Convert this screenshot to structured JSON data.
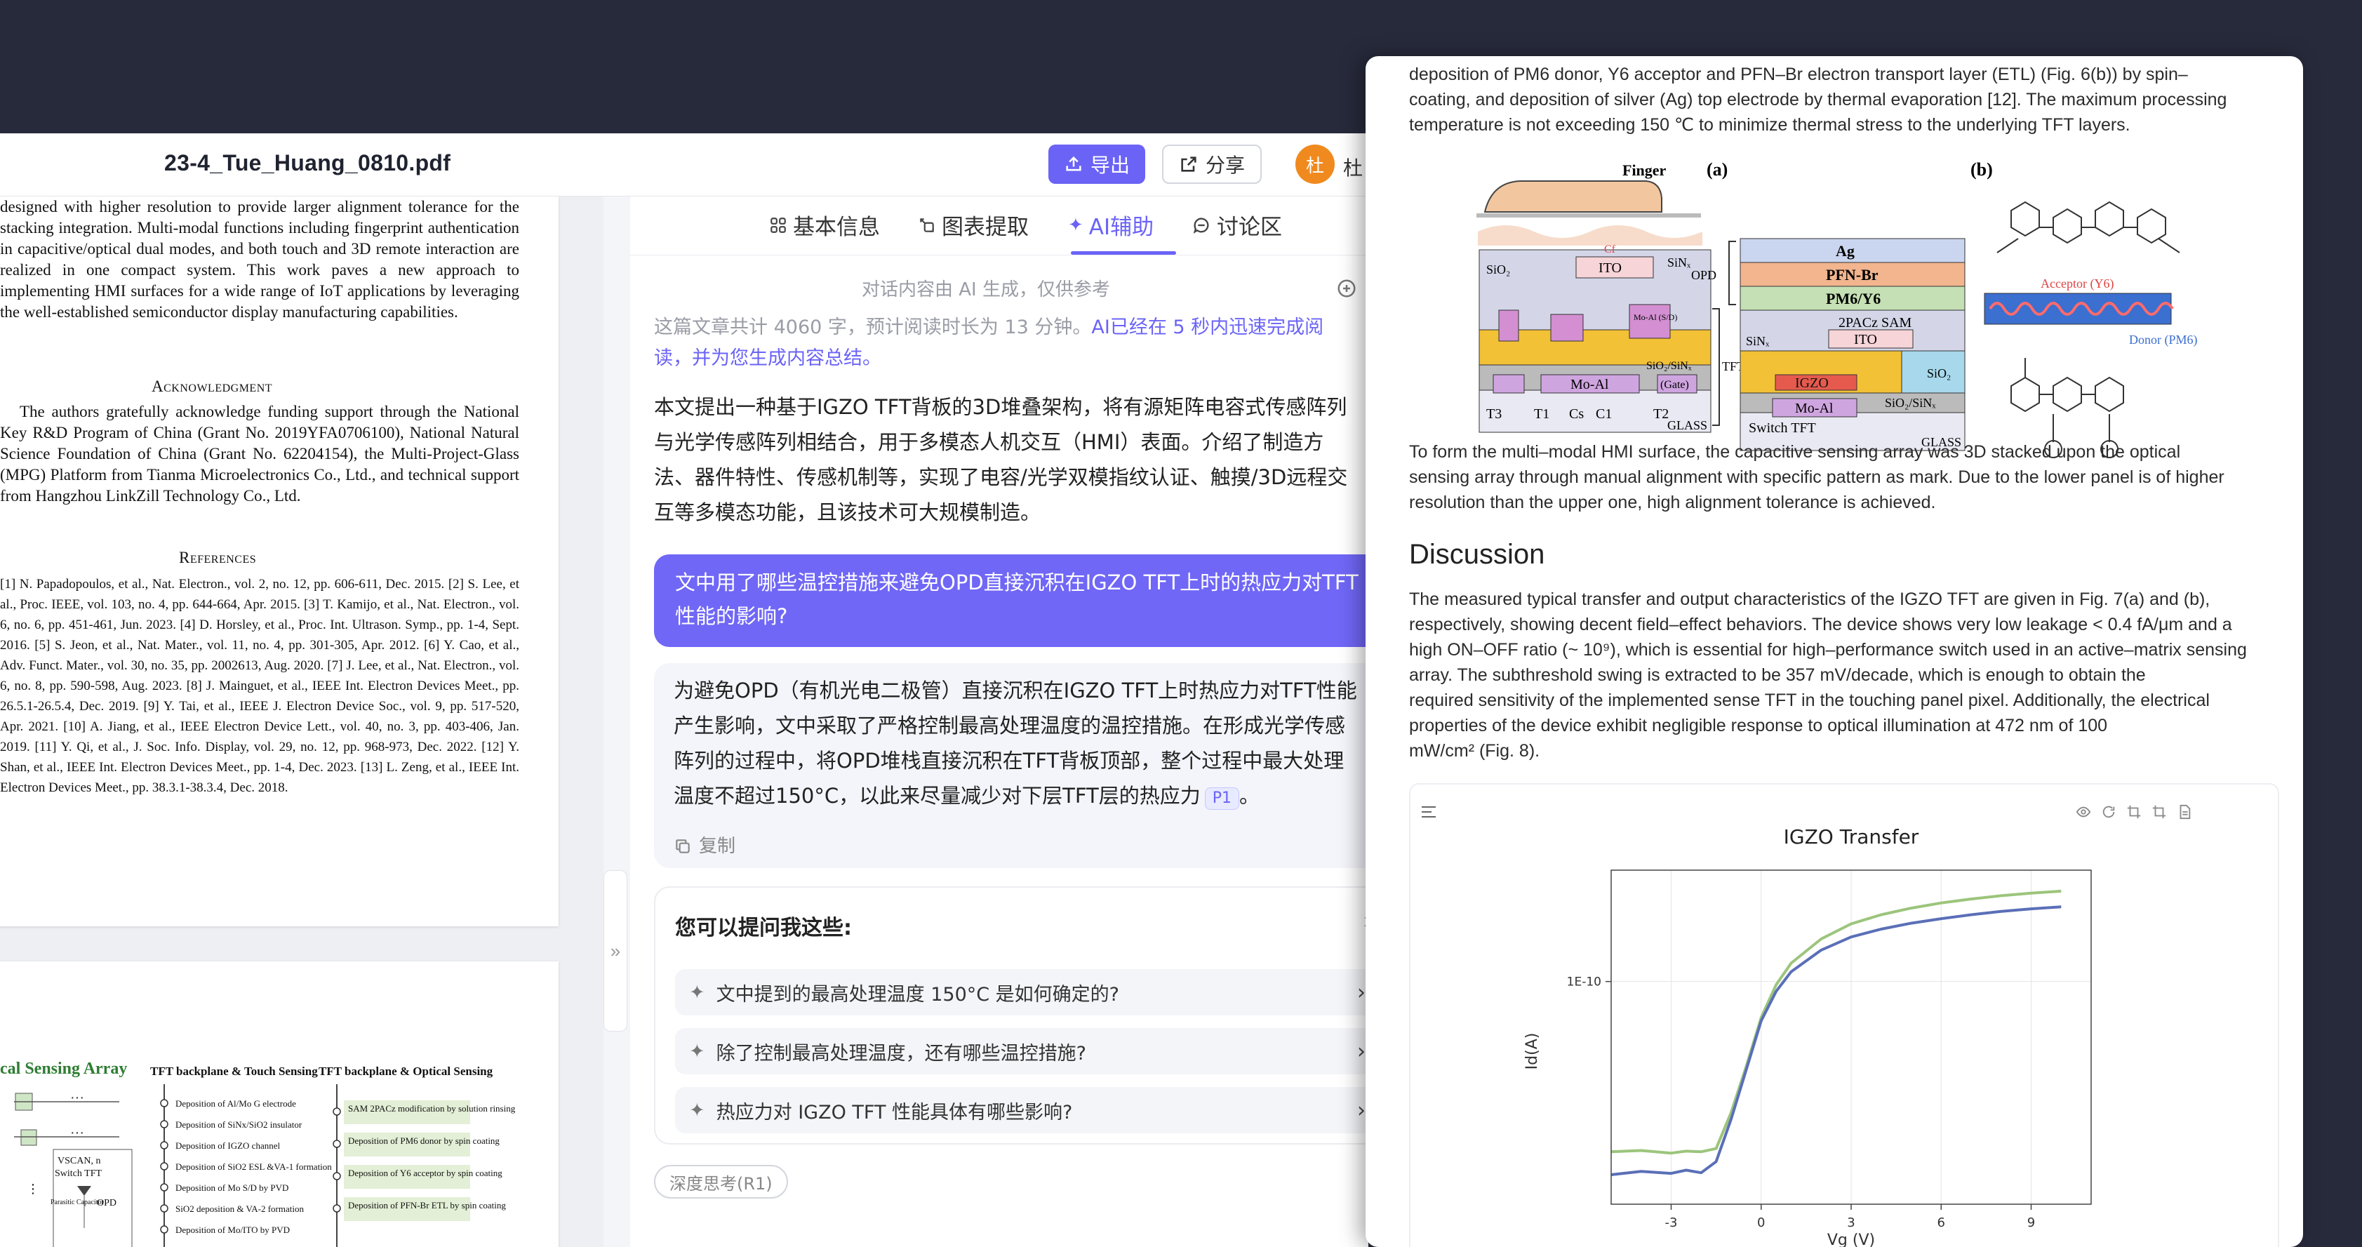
{
  "app": {
    "doc_title": "23-4_Tue_Huang_0810.pdf",
    "export_label": "导出",
    "share_label": "分享",
    "avatar_text": "杜",
    "username": "杜"
  },
  "pdf": {
    "page1_paragraph": "designed with higher resolution to provide larger alignment tolerance for the stacking integration. Multi-modal functions including fingerprint authentication in capacitive/optical dual modes, and both touch and 3D remote interaction are realized in one compact system. This work paves a new approach to implementing HMI surfaces for a wide range of IoT applications by leveraging the well-established semiconductor display manufacturing capabilities.",
    "ack_heading": "Acknowledgment",
    "ack_text": "The authors gratefully acknowledge funding support through the National Key R&D Program of China (Grant No. 2019YFA0706100), National Natural Science Foundation of China (Grant No. 62204154), the Multi-Project-Glass (MPG) Platform from Tianma Microelectronics Co., Ltd., and technical support from Hangzhou LinkZill Technology Co., Ltd.",
    "ref_heading": "References",
    "ref_text": "[1] N. Papadopoulos, et al., Nat. Electron., vol. 2, no. 12, pp. 606-611, Dec. 2015. [2] S. Lee, et al., Proc. IEEE, vol. 103, no. 4, pp. 644-664, Apr. 2015. [3] T. Kamijo, et al., Nat. Electron., vol. 6, no. 6, pp. 451-461, Jun. 2023. [4] D. Horsley, et al., Proc. Int. Ultrason. Symp., pp. 1-4, Sept. 2016. [5] S. Jeon, et al., Nat. Mater., vol. 11, no. 4, pp. 301-305, Apr. 2012. [6] Y. Cao, et al., Adv. Funct. Mater., vol. 30, no. 35, pp. 2002613, Aug. 2020. [7] J. Lee, et al., Nat. Electron., vol. 6, no. 8, pp. 590-598, Aug. 2023. [8] J. Mainguet, et al., IEEE Int. Electron Devices Meet., pp. 26.5.1-26.5.4, Dec. 2019. [9] Y. Tai, et al., IEEE J. Electron Device Soc., vol. 9, pp. 517-520, Apr. 2021. [10] A. Jiang, et al., IEEE Electron Device Lett., vol. 40, no. 3, pp. 403-406, Jan. 2019. [11] Y. Qi, et al., J. Soc. Info. Display, vol. 29, no. 12, pp. 968-973, Dec. 2022. [12] Y. Shan, et al., IEEE Int. Electron Devices Meet., pp. 1-4, Dec. 2023. [13] L. Zeng, et al., IEEE Int. Electron Devices Meet., pp. 38.3.1-38.3.4, Dec. 2018.",
    "fig_col1_title": "cal Sensing Array",
    "fig_col2_title": "TFT backplane & Touch Sensing",
    "fig_col3_title": "TFT backplane & Optical Sensing",
    "fig_col2_steps": [
      "Deposition of Al/Mo G electrode",
      "Deposition of SiNx/SiO2 insulator",
      "Deposition of IGZO channel",
      "Deposition of SiO2 ESL &VA-1 formation",
      "Deposition of Mo S/D by PVD",
      "SiO2 deposition & VA-2 formation",
      "Deposition of Mo/ITO by PVD"
    ],
    "fig_col3_steps": [
      "SAM 2PACz modification by solution rinsing",
      "Deposition of PM6 donor by spin coating",
      "Deposition of Y6 acceptor by spin coating",
      "Deposition of PFN-Br ETL by spin coating"
    ],
    "fig_labels": [
      "VSCAN, n",
      "Switch TFT",
      "Parasitic Capacitor",
      "OPD"
    ]
  },
  "ai_panel": {
    "tabs": [
      {
        "label": "基本信息",
        "icon": "grid-icon"
      },
      {
        "label": "图表提取",
        "icon": "chart-extract-icon"
      },
      {
        "label": "AI辅助",
        "icon": "sparkle-icon"
      },
      {
        "label": "讨论区",
        "icon": "chat-icon"
      }
    ],
    "active_tab": "AI辅助",
    "ai_note": "对话内容由 AI 生成，仅供参考",
    "summary_meta_prefix": "这篇文章共计 4060 字，预计阅读时长为 13 分钟。",
    "summary_meta_highlight": "AI已经在 5 秒内迅速完成阅读，并为您生成内容总结。",
    "summary_body": "本文提出一种基于IGZO TFT背板的3D堆叠架构，将有源矩阵电容式传感阵列与光学传感阵列相结合，用于多模态人机交互（HMI）表面。介绍了制造方法、器件特性、传感机制等，实现了电容/光学双模指纹认证、触摸/3D远程交互等多模态功能，且该技术可大规模制造。",
    "user_question": "文中用了哪些温控措施来避免OPD直接沉积在IGZO TFT上时的热应力对TFT性能的影响?",
    "answer_text": "为避免OPD（有机光电二极管）直接沉积在IGZO TFT上时热应力对TFT性能产生影响，文中采取了严格控制最高处理温度的温控措施。在形成光学传感阵列的过程中，将OPD堆栈直接沉积在TFT背板顶部，整个过程中最大处理温度不超过150°C，以此来尽量减少对下层TFT层的热应力",
    "answer_ref": "P1",
    "copy_label": "复制",
    "suggest_title": "您可以提问我这些:",
    "suggestions": [
      "文中提到的最高处理温度 150°C 是如何确定的?",
      "除了控制最高处理温度，还有哪些温控措施?",
      "热应力对 IGZO TFT 性能具体有哪些影响?"
    ],
    "deep_think_label": "深度思考(R1)"
  },
  "preview": {
    "intro_lines": [
      "deposition of PM6 donor, Y6 acceptor and PFN–Br electron transport layer (ETL) (Fig. 6(b)) by spin–",
      "coating, and deposition of silver (Ag) top electrode by thermal evaporation [12]. The maximum processing",
      "temperature is not exceeding 150 ℃ to minimize thermal stress to the underlying TFT layers."
    ],
    "figure": {
      "panel_a": "(a)",
      "panel_b": "(b)",
      "finger": "Finger",
      "opd": "OPD",
      "tft": "TFT",
      "glass": "GLASS",
      "ag": "Ag",
      "pfnbr": "PFN-Br",
      "pm6y6": "PM6/Y6",
      "sam": "2PACz SAM",
      "ito": "ITO",
      "sio2": "SiO₂",
      "sinx": "SiNₓ",
      "igzo": "IGZO",
      "moal": "Mo-Al",
      "moal_sd": "Mo-Al (S/D)",
      "gate": "(Gate)",
      "sio2sinx": "SiO₂/SiNₓ",
      "switch_tft": "Switch TFT",
      "t_labels": [
        "T3",
        "T1",
        "Cs",
        "C1",
        "T2"
      ],
      "cf": "Cf",
      "acceptor": "Acceptor (Y6)",
      "donor": "Donor (PM6)"
    },
    "para2_lines": [
      "To form the multi–modal HMI surface, the capacitive sensing array was 3D stacked upon the optical",
      "sensing array through manual alignment with specific pattern as mark. Due to the lower panel is of higher",
      "resolution than the upper one, high alignment tolerance is achieved."
    ],
    "heading": "Discussion",
    "para3_lines": [
      "The measured typical transfer and output characteristics of the IGZO TFT are given in Fig. 7(a) and (b),",
      "respectively, showing decent field–effect behaviors. The device shows very low leakage < 0.4 fA/μm and a",
      "high ON–OFF ratio (~ 10⁹), which is essential for high–performance switch used in an active–matrix sensing",
      "array. The subthreshold swing is extracted to be 357 mV/decade, which is enough to obtain the",
      "required sensitivity of the implemented sense TFT in the touching panel pixel. Additionally, the electrical",
      "properties of the device exhibit negligible response to optical illumination at 472 nm of 100",
      "mW/cm² (Fig. 8)."
    ]
  },
  "chart_data": {
    "type": "line",
    "title": "IGZO Transfer",
    "xlabel": "Vg (V)",
    "ylabel": "Id(A)",
    "y_scale": "log",
    "x_ticks": [
      "-3",
      "0",
      "3",
      "6",
      "9"
    ],
    "y_tick_label": "1E-10",
    "xlim": [
      -5,
      11
    ],
    "grid": true,
    "series": [
      {
        "color": "#9cc57c",
        "x": [
          -5,
          -4,
          -3,
          -2.5,
          -2,
          -1.5,
          -1,
          -0.5,
          0,
          0.5,
          1,
          2,
          3,
          4,
          5,
          6,
          7,
          8,
          9,
          10
        ],
        "y": [
          -12.6,
          -12.58,
          -12.62,
          -12.59,
          -12.6,
          -12.55,
          -12.0,
          -11.3,
          -10.55,
          -10.05,
          -9.72,
          -9.35,
          -9.12,
          -8.98,
          -8.88,
          -8.8,
          -8.74,
          -8.69,
          -8.65,
          -8.62
        ]
      },
      {
        "color": "#5a6fb8",
        "x": [
          -5,
          -4,
          -3,
          -2.5,
          -2,
          -1.5,
          -1,
          -0.5,
          0,
          0.5,
          1,
          2,
          3,
          4,
          5,
          6,
          7,
          8,
          9,
          10
        ],
        "y": [
          -12.95,
          -12.9,
          -12.93,
          -12.88,
          -12.92,
          -12.75,
          -12.1,
          -11.35,
          -10.6,
          -10.15,
          -9.85,
          -9.52,
          -9.32,
          -9.2,
          -9.11,
          -9.04,
          -8.98,
          -8.93,
          -8.89,
          -8.86
        ]
      }
    ]
  }
}
